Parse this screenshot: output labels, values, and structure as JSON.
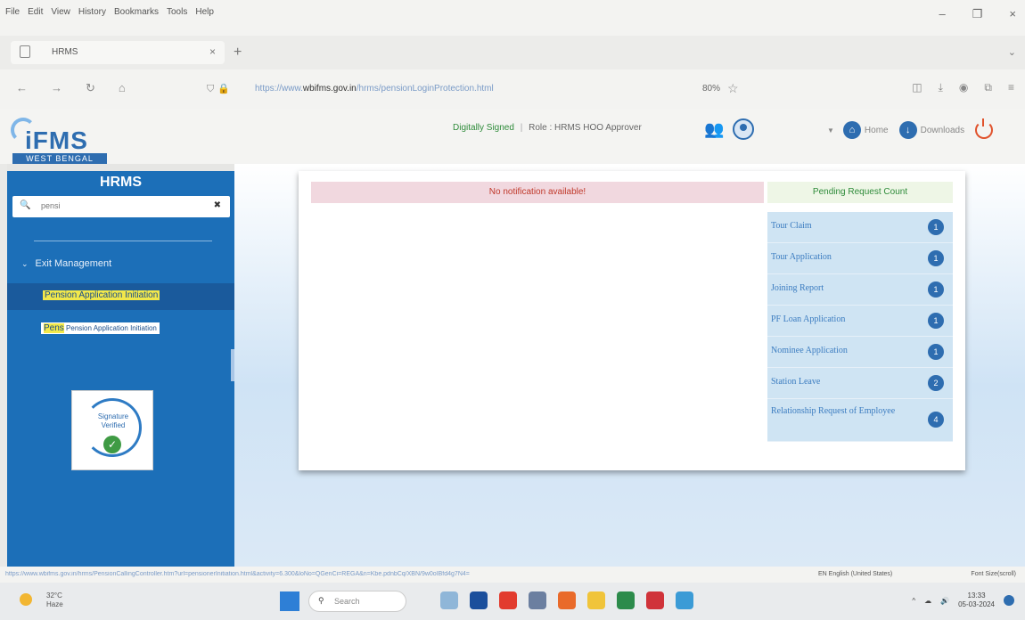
{
  "browser": {
    "menus": [
      "File",
      "Edit",
      "View",
      "History",
      "Bookmarks",
      "Tools",
      "Help"
    ],
    "tab_title": "HRMS",
    "url_prefix": "https://www.",
    "url_domain": "wbifms.gov.in",
    "url_path": "/hrms/pensionLoginProtection.html",
    "zoom": "80%"
  },
  "header": {
    "digitally_signed": "Digitally Signed",
    "role": "Role : HRMS HOO Approver",
    "home_label": "Home",
    "downloads_label": "Downloads",
    "logo_text": "iFMS",
    "logo_strap": "WEST BENGAL"
  },
  "sidebar": {
    "title": "HRMS",
    "search_value": "pensi",
    "group_label": "Exit Management",
    "item_active": "Pension Application Initiation",
    "item2_highlight": "Pens",
    "item2_rest": "Pension Application Initiation",
    "badge_text_1": "Signature",
    "badge_text_2": "Verified"
  },
  "main": {
    "notification": "No notification available!",
    "pending_title": "Pending Request Count",
    "requests": [
      {
        "label": "Tour Claim",
        "count": "1"
      },
      {
        "label": "Tour Application",
        "count": "1"
      },
      {
        "label": "Joining Report",
        "count": "1"
      },
      {
        "label": "PF Loan Application",
        "count": "1"
      },
      {
        "label": "Nominee Application",
        "count": "1"
      },
      {
        "label": "Station Leave",
        "count": "2"
      },
      {
        "label": "Relationship Request of Employee",
        "count": "4"
      }
    ]
  },
  "status": {
    "url": "https://www.wbifms.gov.in/hrms/PensionCallingController.htm?url=pensionerInitiation.html&activity=6.300&loNo=QGenCi=REGA&n=Kbe.pdnbCq/XBN/9w0oIBfd4g7N4=",
    "language": "EN English (United States)",
    "font_size": "Font Size(scroll)"
  },
  "taskbar": {
    "temp": "32°C",
    "weather": "Haze",
    "search_placeholder": "Search",
    "time": "13:33",
    "date": "05-03-2024"
  },
  "colors": {
    "sidebar_bg": "#1c6fb8",
    "accent": "#2e6db0",
    "highlight": "#f2e84a",
    "notification_red": "#c0392b",
    "pending_green": "#2e8b3a"
  }
}
